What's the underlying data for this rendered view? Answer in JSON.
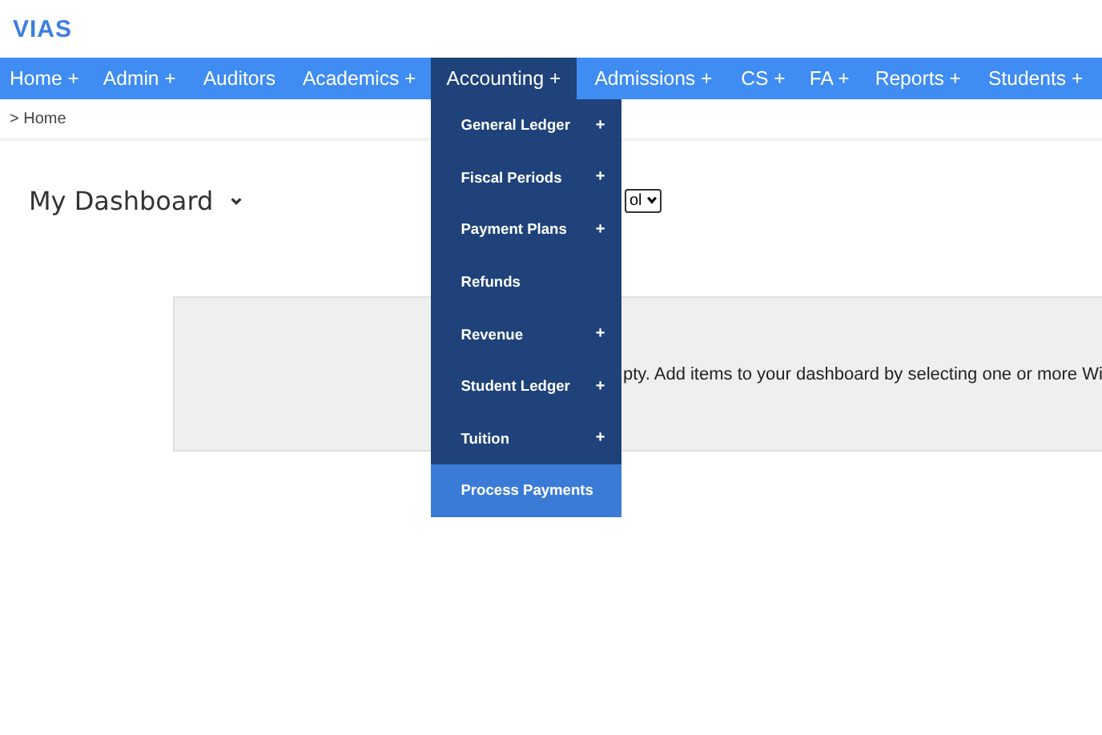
{
  "logo": "VIAS",
  "nav": [
    {
      "label": "Home +",
      "selected": false
    },
    {
      "label": "Admin +",
      "selected": false
    },
    {
      "label": "Auditors",
      "selected": false
    },
    {
      "label": "Academics +",
      "selected": false
    },
    {
      "label": "Accounting +",
      "selected": true,
      "menu": [
        {
          "label": "General Ledger",
          "submenu": "+",
          "selected": false
        },
        {
          "label": "Fiscal Periods",
          "submenu": "+",
          "selected": false
        },
        {
          "label": "Payment Plans",
          "submenu": "+",
          "selected": false
        },
        {
          "label": "Refunds",
          "selected": false
        },
        {
          "label": "Revenue",
          "submenu": "+",
          "selected": false
        },
        {
          "label": "Student Ledger",
          "submenu": "+",
          "selected": false
        },
        {
          "label": "Tuition",
          "submenu": "+",
          "selected": false
        },
        {
          "label": "Process Payments",
          "selected": true
        }
      ]
    },
    {
      "label": "Admissions +",
      "selected": false
    },
    {
      "label": "CS +",
      "selected": false
    },
    {
      "label": "FA +",
      "selected": false
    },
    {
      "label": "Reports +",
      "selected": false
    },
    {
      "label": "Students +",
      "selected": false
    }
  ],
  "breadcrumb": "> Home",
  "dashboard": {
    "title": "My Dashboard",
    "select_value": "ol",
    "empty_message": "pty. Add items to your dashboard by selecting one or more Wi"
  }
}
